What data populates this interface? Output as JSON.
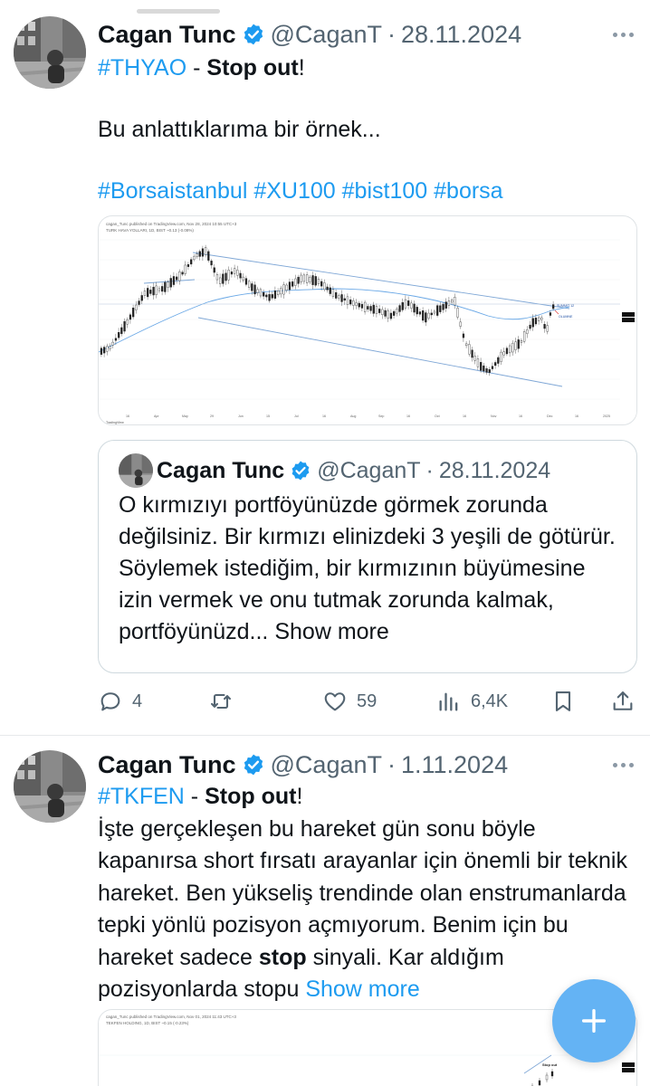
{
  "tweets": [
    {
      "author": {
        "name": "Cagan Tunc",
        "handle": "@CaganT",
        "date": "28.11.2024"
      },
      "text": {
        "ticker": "#THYAO",
        "dash": " - ",
        "stop": "Stop out",
        "bang": "!",
        "line2": "Bu anlattıklarıma bir örnek...",
        "hashtags": [
          "#Borsaistanbul",
          "#XU100",
          "#bist100",
          "#borsa"
        ]
      },
      "chart": {
        "header": "cagan_Tunc published on TradingView.com, Nov 28, 2024 10:55 UTC+3",
        "symbol": "TURK HAVA YOLLARI, 1D, BIST  ~0.13 (-0.08%)",
        "label_a": "SUMMIT 12",
        "label_b": "OLUMNE",
        "x_labels": [
          "16",
          "Apr",
          "May",
          "29",
          "Jun",
          "15",
          "Jul",
          "16",
          "Aug",
          "Sep",
          "16",
          "Oct",
          "16",
          "Nov",
          "16",
          "Dec",
          "16",
          "2025"
        ],
        "brand": "TradingView"
      },
      "quote": {
        "author": {
          "name": "Cagan Tunc",
          "handle": "@CaganT",
          "date": "28.11.2024"
        },
        "text": "O kırmızıyı portföyünüzde görmek zorunda değilsiniz. Bir kırmızı elinizdeki 3 yeşili de götürür. Söylemek istediğim, bir kırmızının büyümesine izin vermek ve onu tutmak zorunda kalmak, portföyünüzd...",
        "show_more": "Show more"
      },
      "actions": {
        "replies": "4",
        "reposts": "",
        "likes": "59",
        "views": "6,4K"
      }
    },
    {
      "author": {
        "name": "Cagan Tunc",
        "handle": "@CaganT",
        "date": "1.11.2024"
      },
      "text": {
        "ticker": "#TKFEN",
        "dash": " - ",
        "stop": "Stop out",
        "bang": "!",
        "body_before": "İşte gerçekleşen bu hareket gün sonu böyle kapanırsa short fırsatı arayanlar için önemli bir teknik hareket. Ben yükseliş trendinde olan enstrumanlarda tepki yönlü pozisyon açmıyorum. Benim için bu hareket sadece ",
        "body_bold": "stop",
        "body_after": " sinyali. Kar aldığım pozisyonlarda stopu ",
        "show_more": "Show more"
      },
      "chart": {
        "header": "cagan_Tunc published on TradingView.com, Nov 01, 2024 11:43 UTC+3",
        "symbol": "TEKFEN HOLDING, 1D, BIST  ~0.15 (-0.23%)",
        "annotation": "Stop out"
      }
    }
  ],
  "colors": {
    "accent": "#1d9bf0",
    "muted": "#536471",
    "fab": "#64b3f4",
    "verified": "#1d9bf0"
  },
  "icons": [
    "more-icon",
    "verified-badge-icon",
    "reply-icon",
    "repost-icon",
    "like-icon",
    "views-icon",
    "bookmark-icon",
    "share-icon",
    "compose-plus-icon"
  ]
}
